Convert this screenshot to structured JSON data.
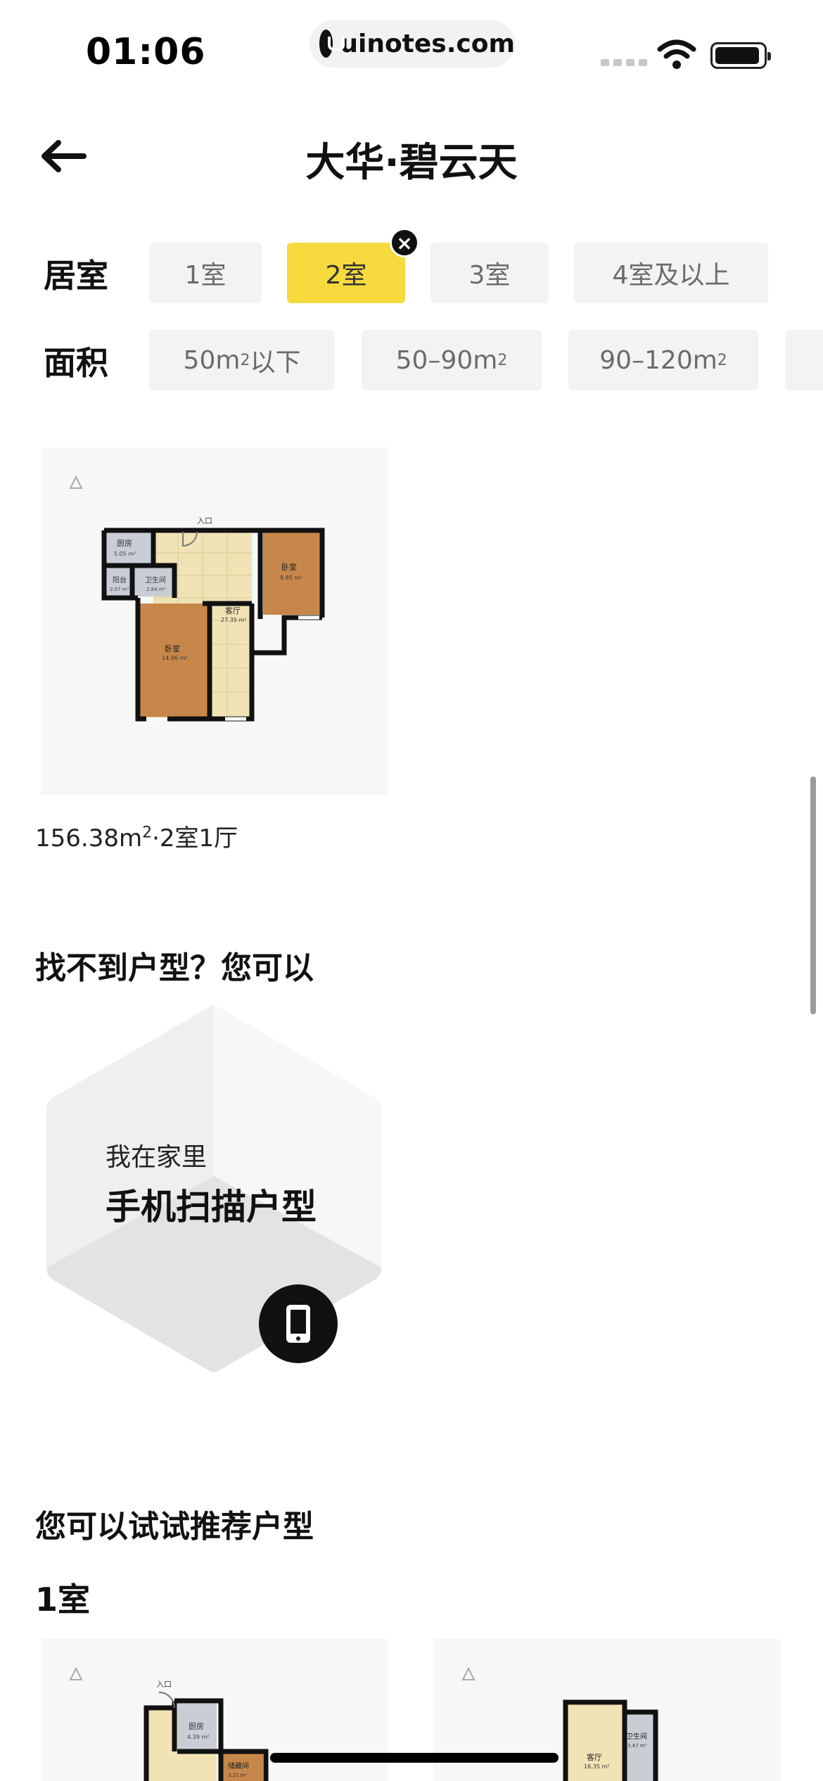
{
  "status_bar": {
    "time": "01:06",
    "url": "uinotes.com"
  },
  "header": {
    "title": "大华·碧云天",
    "back_icon": "arrow-left-icon"
  },
  "filters": {
    "rooms": {
      "label": "居室",
      "options": [
        "1室",
        "2室",
        "3室",
        "4室及以上"
      ],
      "selected": "2室",
      "clear_symbol": "×"
    },
    "area": {
      "label": "面积",
      "options": [
        {
          "base": "50m",
          "sup": "2",
          "suffix": "以下"
        },
        {
          "base": "50–90m",
          "sup": "2",
          "suffix": ""
        },
        {
          "base": "90–120m",
          "sup": "2",
          "suffix": ""
        }
      ]
    }
  },
  "result": {
    "caption_area": "156.38m",
    "caption_sup": "2",
    "caption_rest": "·2室1厅",
    "plan_labels": {
      "entrance": "入口",
      "kitchen": "厨房",
      "kitchen_area": "5.05 m²",
      "bedroom_a": "卧室",
      "bedroom_a_area": "9.85 m²",
      "balcony": "阳台",
      "balcony_area": "2.07 m²",
      "bathroom": "卫生间",
      "bathroom_area": "2.84 m²",
      "living": "客厅",
      "living_area": "27.35 m²",
      "bedroom_b": "卧室",
      "bedroom_b_area": "14.96 m²"
    }
  },
  "fallback": {
    "title": "找不到户型？您可以",
    "scan_subtitle": "我在家里",
    "scan_title": "手机扫描户型",
    "icon": "phone-icon"
  },
  "recommend": {
    "title": "您可以试试推荐户型",
    "group_title": "1室",
    "plan1_labels": {
      "entrance": "入口",
      "kitchen": "厨房",
      "kitchen_area": "4.39 m²",
      "storage": "储藏间",
      "storage_area": "3.21 m²"
    },
    "plan2_labels": {
      "bathroom": "卫生间",
      "bathroom_area": "3.47 m²",
      "living": "客厅",
      "living_area": "16.35 m²"
    }
  },
  "colors": {
    "accent_yellow": "#f6da3e",
    "chip_bg": "#f3f3f3",
    "floor_wood": "#c8874a",
    "floor_tile": "#f1e3b6",
    "wall": "#111111"
  }
}
